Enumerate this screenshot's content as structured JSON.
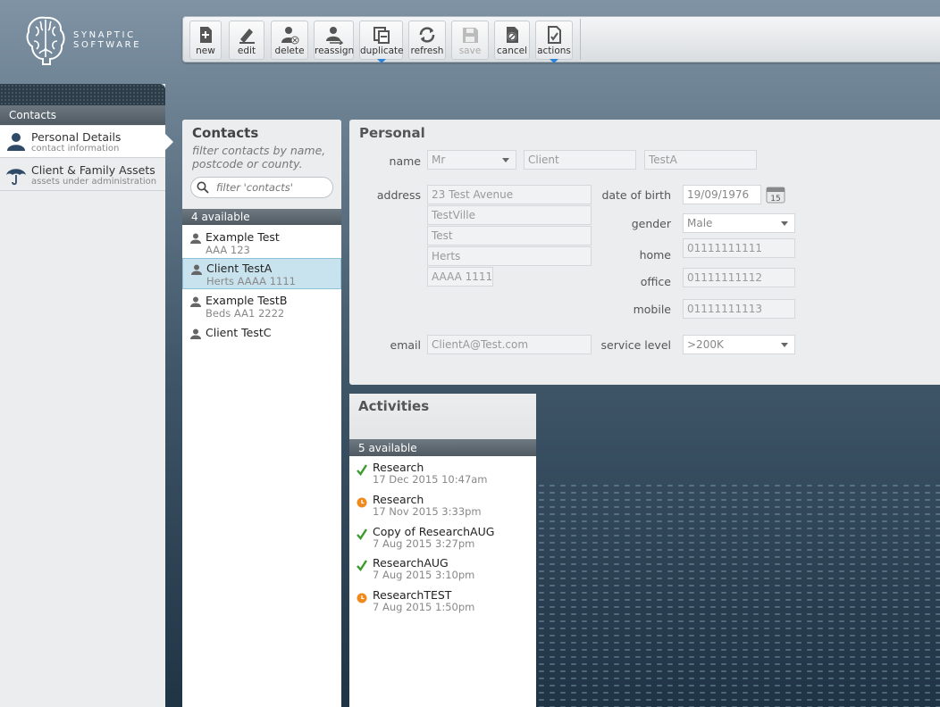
{
  "brand": {
    "line1": "SYNAPTIC",
    "line2": "SOFTWARE"
  },
  "toolbar": {
    "buttons": [
      {
        "label": "new",
        "icon": "new-document-icon"
      },
      {
        "label": "edit",
        "icon": "edit-pen-icon"
      },
      {
        "label": "delete",
        "icon": "delete-person-icon"
      },
      {
        "label": "reassign",
        "icon": "reassign-person-icon"
      },
      {
        "label": "duplicate",
        "icon": "duplicate-icon"
      },
      {
        "label": "refresh",
        "icon": "refresh-icon"
      },
      {
        "label": "save",
        "icon": "save-disk-icon"
      },
      {
        "label": "cancel",
        "icon": "cancel-icon"
      },
      {
        "label": "actions",
        "icon": "actions-icon"
      }
    ]
  },
  "sidebar": {
    "header": "Contacts",
    "items": [
      {
        "title": "Personal Details",
        "subtitle": "contact information"
      },
      {
        "title": "Client & Family Assets",
        "subtitle": "assets under administration"
      }
    ]
  },
  "contacts": {
    "title": "Contacts",
    "hint": "filter contacts by name, postcode or county.",
    "search_placeholder": "filter 'contacts'",
    "count": "4 available",
    "items": [
      {
        "name": "Example Test",
        "sub": "AAA 123"
      },
      {
        "name": "Client TestA",
        "sub": "Herts AAAA 1111"
      },
      {
        "name": "Example TestB",
        "sub": "Beds AA1 2222"
      },
      {
        "name": "Client TestC",
        "sub": ""
      }
    ]
  },
  "personal": {
    "title": "Personal",
    "labels": {
      "name": "name",
      "address": "address",
      "email": "email",
      "dob": "date of birth",
      "gender": "gender",
      "home": "home",
      "office": "office",
      "mobile": "mobile",
      "service_level": "service level"
    },
    "values": {
      "salutation": "Mr",
      "first_name": "Client",
      "last_name": "TestA",
      "address1": "23 Test Avenue",
      "address2": "TestVille",
      "address3": "Test",
      "address4": "Herts",
      "postcode": "AAAA 1111",
      "email": "ClientA@Test.com",
      "dob": "19/09/1976",
      "calendar_day": "15",
      "gender": "Male",
      "home": "01111111111",
      "office": "01111111112",
      "mobile": "01111111113",
      "service_level": ">200K"
    }
  },
  "activities": {
    "title": "Activities",
    "count": "5 available",
    "items": [
      {
        "name": "Research",
        "date": "17 Dec 2015 10:47am",
        "status": "done"
      },
      {
        "name": "Research",
        "date": "17 Nov 2015 3:33pm",
        "status": "pending"
      },
      {
        "name": "Copy of ResearchAUG",
        "date": "7 Aug 2015 3:27pm",
        "status": "done"
      },
      {
        "name": "ResearchAUG",
        "date": "7 Aug 2015 3:10pm",
        "status": "done"
      },
      {
        "name": "ResearchTEST",
        "date": "7 Aug 2015 1:50pm",
        "status": "pending"
      }
    ]
  },
  "colors": {
    "done": "#3a9a2a",
    "pending": "#f08a1c",
    "accent": "#2b83d6"
  }
}
